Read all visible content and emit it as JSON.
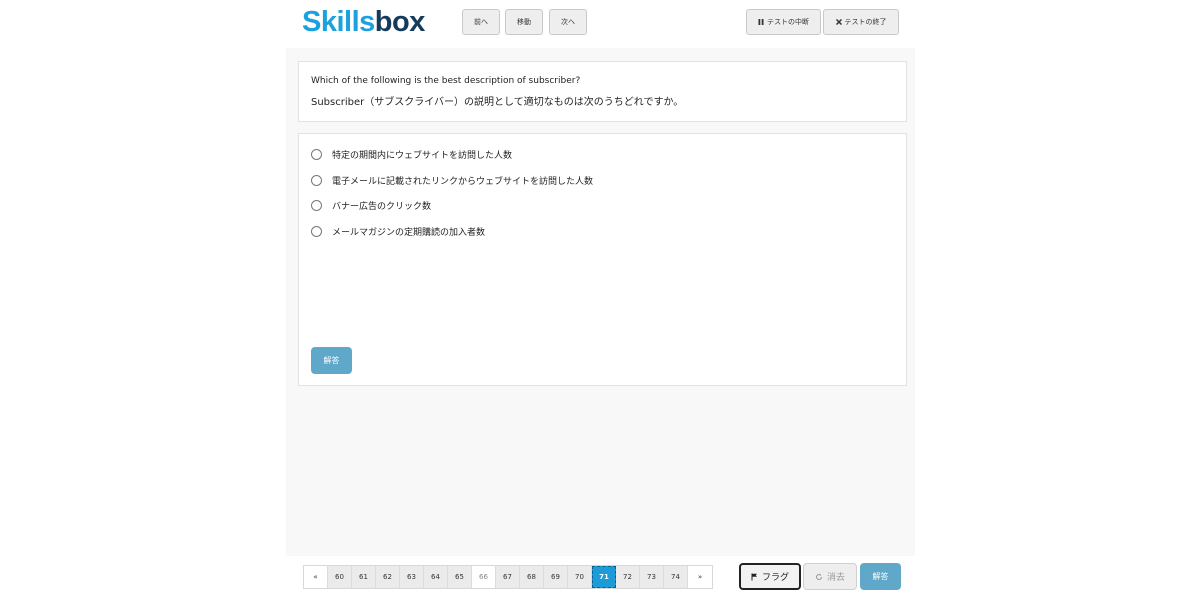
{
  "header": {
    "logo_part1": "Skills",
    "logo_part2": "box",
    "nav": {
      "prev": "前へ",
      "move": "移動",
      "next": "次へ"
    },
    "pause": {
      "icon": "pause-icon",
      "label": "テストの中断"
    },
    "end": {
      "icon": "close-icon",
      "label": "テストの終了"
    }
  },
  "question": {
    "english": "Which of the following is the best description of subscriber?",
    "japanese": "Subscriber（サブスクライバー）の説明として適切なものは次のうちどれですか。"
  },
  "options": [
    "特定の期間内にウェブサイトを訪問した人数",
    "電子メールに記載されたリンクからウェブサイトを訪問した人数",
    "バナー広告のクリック数",
    "メールマガジンの定期購読の加入者数"
  ],
  "answer_button": "解答",
  "pager": {
    "prev": "«",
    "next": "»",
    "pages": [
      "60",
      "61",
      "62",
      "63",
      "64",
      "65",
      "66",
      "67",
      "68",
      "69",
      "70",
      "71",
      "72",
      "73",
      "74"
    ],
    "current": "71"
  },
  "footer": {
    "flag": {
      "icon": "flag-icon",
      "label": "フラグ"
    },
    "clear": {
      "icon": "refresh-icon",
      "label": "消去"
    },
    "submit": "解答"
  },
  "colors": {
    "accent": "#1c9bd8",
    "button_blue": "#5fa8c9",
    "logo_blue": "#1ba1de",
    "logo_navy": "#163a5a"
  }
}
